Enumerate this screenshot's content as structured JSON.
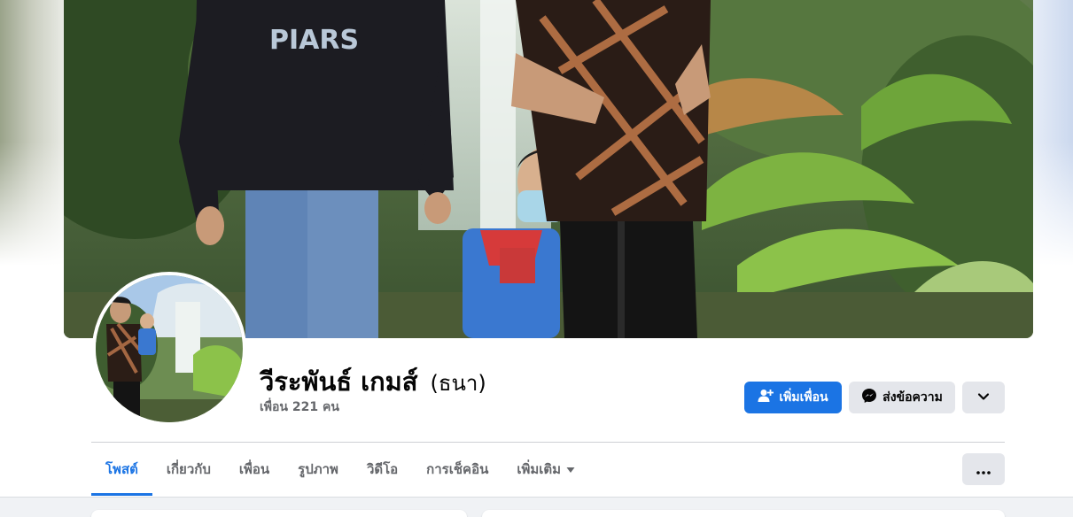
{
  "profile": {
    "name": "วีระพันธ์ เกมส์",
    "alternate_name": "(ธนา)",
    "friends_count": "เพื่อน 221 คน"
  },
  "cover": {
    "shirt_text": "PIARS"
  },
  "actions": {
    "add_friend_label": "เพิ่มเพื่อน",
    "add_friend_icon": "person-add-icon",
    "message_label": "ส่งข้อความ",
    "message_icon": "messenger-icon",
    "more_icon": "chevron-down-icon"
  },
  "tabs": [
    {
      "label": "โพสต์",
      "active": true
    },
    {
      "label": "เกี่ยวกับ",
      "active": false
    },
    {
      "label": "เพื่อน",
      "active": false
    },
    {
      "label": "รูปภาพ",
      "active": false
    },
    {
      "label": "วิดีโอ",
      "active": false
    },
    {
      "label": "การเช็คอิน",
      "active": false
    },
    {
      "label": "เพิ่มเติม",
      "active": false,
      "dropdown": true
    }
  ],
  "tab_more_icon": "ellipsis-icon",
  "colors": {
    "accent": "#1b74e4",
    "secondary_button": "#e4e6eb",
    "muted_text": "#65676b",
    "page_background": "#f0f2f5"
  }
}
